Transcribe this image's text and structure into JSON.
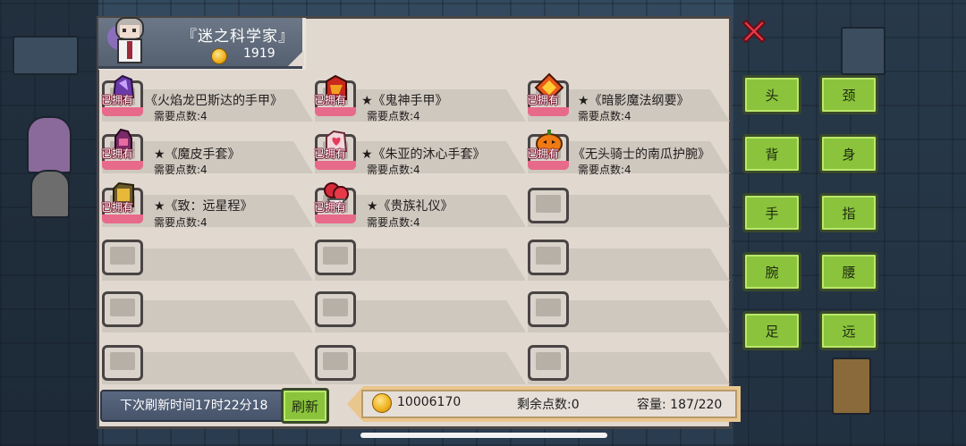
{
  "header": {
    "title": "『迷之科学家』",
    "coins": "1919"
  },
  "items": [
    {
      "name": "《火焰龙巴斯达的手甲》",
      "points": "需要点数:4",
      "owned": "已拥有",
      "icon": "flame-gauntlet-icon"
    },
    {
      "name": "★《鬼神手甲》",
      "points": "需要点数:4",
      "owned": "已拥有",
      "icon": "demon-gauntlet-icon"
    },
    {
      "name": "★《暗影魔法纲要》",
      "points": "需要点数:4",
      "owned": "已拥有",
      "icon": "shadow-spellbook-icon"
    },
    {
      "name": "★《魔皮手套》",
      "points": "需要点数:4",
      "owned": "已拥有",
      "icon": "demon-glove-icon"
    },
    {
      "name": "★《朱亚的沐心手套》",
      "points": "需要点数:4",
      "owned": "已拥有",
      "icon": "heart-glove-icon"
    },
    {
      "name": "《无头骑士的南瓜护腕》",
      "points": "需要点数:4",
      "owned": "已拥有",
      "icon": "pumpkin-bracer-icon"
    },
    {
      "name": "★《致：远星程》",
      "points": "需要点数:4",
      "owned": "已拥有",
      "icon": "gold-gauntlet-icon"
    },
    {
      "name": "★《贵族礼仪》",
      "points": "需要点数:4",
      "owned": "已拥有",
      "icon": "noble-rose-icon"
    }
  ],
  "categories": [
    "头",
    "颈",
    "背",
    "身",
    "手",
    "指",
    "腕",
    "腰",
    "足",
    "远"
  ],
  "footer": {
    "refresh_text": "下次刷新时间17时22分18",
    "refresh_button": "刷新",
    "gold": "10006170",
    "remaining_points": "剩余点数:0",
    "capacity": "容量:  187/220"
  },
  "colors": {
    "accent_green": "#8bc43c",
    "owned_pink": "#e86a8b",
    "panel_bg": "#e1d9d0"
  }
}
